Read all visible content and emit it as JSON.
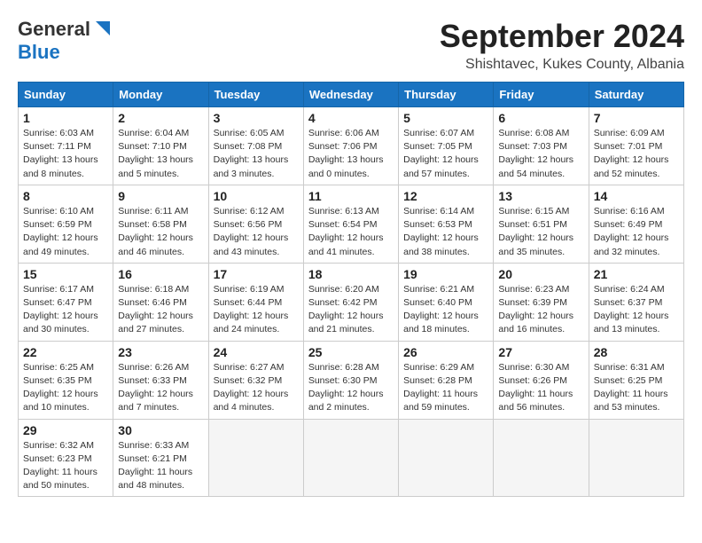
{
  "header": {
    "logo_general": "General",
    "logo_blue": "Blue",
    "month_year": "September 2024",
    "location": "Shishtavec, Kukes County, Albania"
  },
  "days_of_week": [
    "Sunday",
    "Monday",
    "Tuesday",
    "Wednesday",
    "Thursday",
    "Friday",
    "Saturday"
  ],
  "weeks": [
    [
      {
        "day": "1",
        "lines": [
          "Sunrise: 6:03 AM",
          "Sunset: 7:11 PM",
          "Daylight: 13 hours",
          "and 8 minutes."
        ]
      },
      {
        "day": "2",
        "lines": [
          "Sunrise: 6:04 AM",
          "Sunset: 7:10 PM",
          "Daylight: 13 hours",
          "and 5 minutes."
        ]
      },
      {
        "day": "3",
        "lines": [
          "Sunrise: 6:05 AM",
          "Sunset: 7:08 PM",
          "Daylight: 13 hours",
          "and 3 minutes."
        ]
      },
      {
        "day": "4",
        "lines": [
          "Sunrise: 6:06 AM",
          "Sunset: 7:06 PM",
          "Daylight: 13 hours",
          "and 0 minutes."
        ]
      },
      {
        "day": "5",
        "lines": [
          "Sunrise: 6:07 AM",
          "Sunset: 7:05 PM",
          "Daylight: 12 hours",
          "and 57 minutes."
        ]
      },
      {
        "day": "6",
        "lines": [
          "Sunrise: 6:08 AM",
          "Sunset: 7:03 PM",
          "Daylight: 12 hours",
          "and 54 minutes."
        ]
      },
      {
        "day": "7",
        "lines": [
          "Sunrise: 6:09 AM",
          "Sunset: 7:01 PM",
          "Daylight: 12 hours",
          "and 52 minutes."
        ]
      }
    ],
    [
      {
        "day": "8",
        "lines": [
          "Sunrise: 6:10 AM",
          "Sunset: 6:59 PM",
          "Daylight: 12 hours",
          "and 49 minutes."
        ]
      },
      {
        "day": "9",
        "lines": [
          "Sunrise: 6:11 AM",
          "Sunset: 6:58 PM",
          "Daylight: 12 hours",
          "and 46 minutes."
        ]
      },
      {
        "day": "10",
        "lines": [
          "Sunrise: 6:12 AM",
          "Sunset: 6:56 PM",
          "Daylight: 12 hours",
          "and 43 minutes."
        ]
      },
      {
        "day": "11",
        "lines": [
          "Sunrise: 6:13 AM",
          "Sunset: 6:54 PM",
          "Daylight: 12 hours",
          "and 41 minutes."
        ]
      },
      {
        "day": "12",
        "lines": [
          "Sunrise: 6:14 AM",
          "Sunset: 6:53 PM",
          "Daylight: 12 hours",
          "and 38 minutes."
        ]
      },
      {
        "day": "13",
        "lines": [
          "Sunrise: 6:15 AM",
          "Sunset: 6:51 PM",
          "Daylight: 12 hours",
          "and 35 minutes."
        ]
      },
      {
        "day": "14",
        "lines": [
          "Sunrise: 6:16 AM",
          "Sunset: 6:49 PM",
          "Daylight: 12 hours",
          "and 32 minutes."
        ]
      }
    ],
    [
      {
        "day": "15",
        "lines": [
          "Sunrise: 6:17 AM",
          "Sunset: 6:47 PM",
          "Daylight: 12 hours",
          "and 30 minutes."
        ]
      },
      {
        "day": "16",
        "lines": [
          "Sunrise: 6:18 AM",
          "Sunset: 6:46 PM",
          "Daylight: 12 hours",
          "and 27 minutes."
        ]
      },
      {
        "day": "17",
        "lines": [
          "Sunrise: 6:19 AM",
          "Sunset: 6:44 PM",
          "Daylight: 12 hours",
          "and 24 minutes."
        ]
      },
      {
        "day": "18",
        "lines": [
          "Sunrise: 6:20 AM",
          "Sunset: 6:42 PM",
          "Daylight: 12 hours",
          "and 21 minutes."
        ]
      },
      {
        "day": "19",
        "lines": [
          "Sunrise: 6:21 AM",
          "Sunset: 6:40 PM",
          "Daylight: 12 hours",
          "and 18 minutes."
        ]
      },
      {
        "day": "20",
        "lines": [
          "Sunrise: 6:23 AM",
          "Sunset: 6:39 PM",
          "Daylight: 12 hours",
          "and 16 minutes."
        ]
      },
      {
        "day": "21",
        "lines": [
          "Sunrise: 6:24 AM",
          "Sunset: 6:37 PM",
          "Daylight: 12 hours",
          "and 13 minutes."
        ]
      }
    ],
    [
      {
        "day": "22",
        "lines": [
          "Sunrise: 6:25 AM",
          "Sunset: 6:35 PM",
          "Daylight: 12 hours",
          "and 10 minutes."
        ]
      },
      {
        "day": "23",
        "lines": [
          "Sunrise: 6:26 AM",
          "Sunset: 6:33 PM",
          "Daylight: 12 hours",
          "and 7 minutes."
        ]
      },
      {
        "day": "24",
        "lines": [
          "Sunrise: 6:27 AM",
          "Sunset: 6:32 PM",
          "Daylight: 12 hours",
          "and 4 minutes."
        ]
      },
      {
        "day": "25",
        "lines": [
          "Sunrise: 6:28 AM",
          "Sunset: 6:30 PM",
          "Daylight: 12 hours",
          "and 2 minutes."
        ]
      },
      {
        "day": "26",
        "lines": [
          "Sunrise: 6:29 AM",
          "Sunset: 6:28 PM",
          "Daylight: 11 hours",
          "and 59 minutes."
        ]
      },
      {
        "day": "27",
        "lines": [
          "Sunrise: 6:30 AM",
          "Sunset: 6:26 PM",
          "Daylight: 11 hours",
          "and 56 minutes."
        ]
      },
      {
        "day": "28",
        "lines": [
          "Sunrise: 6:31 AM",
          "Sunset: 6:25 PM",
          "Daylight: 11 hours",
          "and 53 minutes."
        ]
      }
    ],
    [
      {
        "day": "29",
        "lines": [
          "Sunrise: 6:32 AM",
          "Sunset: 6:23 PM",
          "Daylight: 11 hours",
          "and 50 minutes."
        ]
      },
      {
        "day": "30",
        "lines": [
          "Sunrise: 6:33 AM",
          "Sunset: 6:21 PM",
          "Daylight: 11 hours",
          "and 48 minutes."
        ]
      },
      {
        "day": "",
        "lines": []
      },
      {
        "day": "",
        "lines": []
      },
      {
        "day": "",
        "lines": []
      },
      {
        "day": "",
        "lines": []
      },
      {
        "day": "",
        "lines": []
      }
    ]
  ]
}
